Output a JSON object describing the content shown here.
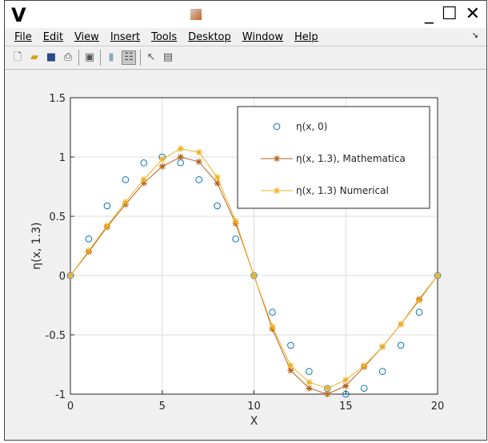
{
  "window": {
    "logo": "V",
    "controls": [
      "_",
      "☐",
      "✕"
    ]
  },
  "menu": [
    "File",
    "Edit",
    "View",
    "Insert",
    "Tools",
    "Desktop",
    "Window",
    "Help"
  ],
  "toolbar": [
    "new-file",
    "open-file",
    "save",
    "print",
    "print-preview",
    "colorbar",
    "legend",
    "pointer",
    "property-editor"
  ],
  "colors": {
    "series0": "#0072BD",
    "series1": "#B5621E",
    "series2": "#EDB120"
  },
  "chart_data": {
    "type": "line",
    "xlabel": "X",
    "ylabel": "η(x, 1.3)",
    "xlim": [
      0,
      20
    ],
    "ylim": [
      -1,
      1.5
    ],
    "xticks": [
      "0",
      "5",
      "10",
      "15",
      "20"
    ],
    "yticks": [
      "-1",
      "-0.5",
      "0",
      "0.5",
      "1",
      "1.5"
    ],
    "grid": true,
    "legend_position": "top-right",
    "x": [
      0,
      1,
      2,
      3,
      4,
      5,
      6,
      7,
      8,
      9,
      10,
      11,
      12,
      13,
      14,
      15,
      16,
      17,
      18,
      19,
      20
    ],
    "series": [
      {
        "name": "η(x, 0)",
        "marker": "o",
        "line": false,
        "values": [
          0,
          0.309,
          0.588,
          0.809,
          0.951,
          1,
          0.951,
          0.809,
          0.588,
          0.309,
          0,
          -0.309,
          -0.588,
          -0.809,
          -0.951,
          -1,
          -0.951,
          -0.809,
          -0.588,
          -0.309,
          0
        ]
      },
      {
        "name": "η(x, 1.3), Mathematica",
        "marker": "*",
        "line": true,
        "values": [
          0,
          0.2,
          0.41,
          0.6,
          0.78,
          0.92,
          1.0,
          0.96,
          0.78,
          0.44,
          0,
          -0.45,
          -0.8,
          -0.95,
          -1.0,
          -0.93,
          -0.77,
          -0.6,
          -0.41,
          -0.2,
          0
        ]
      },
      {
        "name": "η(x, 1.3) Numerical",
        "marker": "*",
        "line": true,
        "values": [
          0,
          0.21,
          0.42,
          0.62,
          0.81,
          0.98,
          1.07,
          1.04,
          0.83,
          0.46,
          0,
          -0.43,
          -0.76,
          -0.9,
          -0.95,
          -0.88,
          -0.76,
          -0.6,
          -0.41,
          -0.21,
          0
        ]
      }
    ]
  }
}
